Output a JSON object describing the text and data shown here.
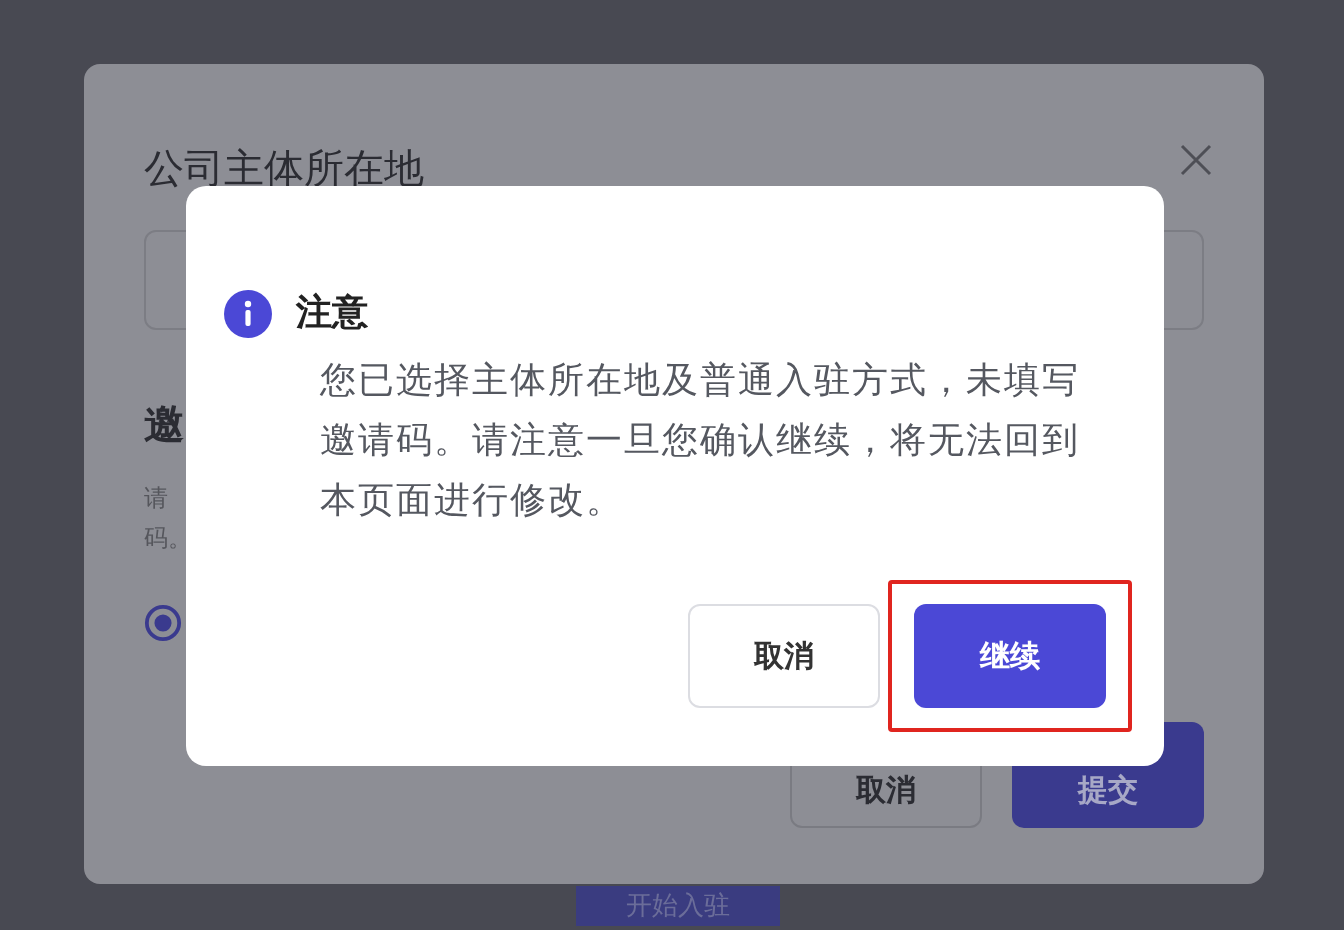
{
  "page": {
    "start_button": "开始入驻"
  },
  "background_modal": {
    "title": "公司主体所在地",
    "section_heading": "邀",
    "hint_lines": [
      "请",
      "码。"
    ],
    "radio": {
      "selected": true
    },
    "buttons": [
      {
        "label": "取消",
        "kind": "secondary"
      },
      {
        "label": "提交",
        "kind": "primary"
      }
    ]
  },
  "dialog": {
    "title": "注意",
    "message": "您已选择主体所在地及普通入驻方式，未填写邀请码。请注意一旦您确认继续，将无法回到本页面进行修改。",
    "buttons": [
      {
        "label": "取消",
        "kind": "secondary",
        "highlighted": false
      },
      {
        "label": "继续",
        "kind": "primary",
        "highlighted": true
      }
    ]
  }
}
